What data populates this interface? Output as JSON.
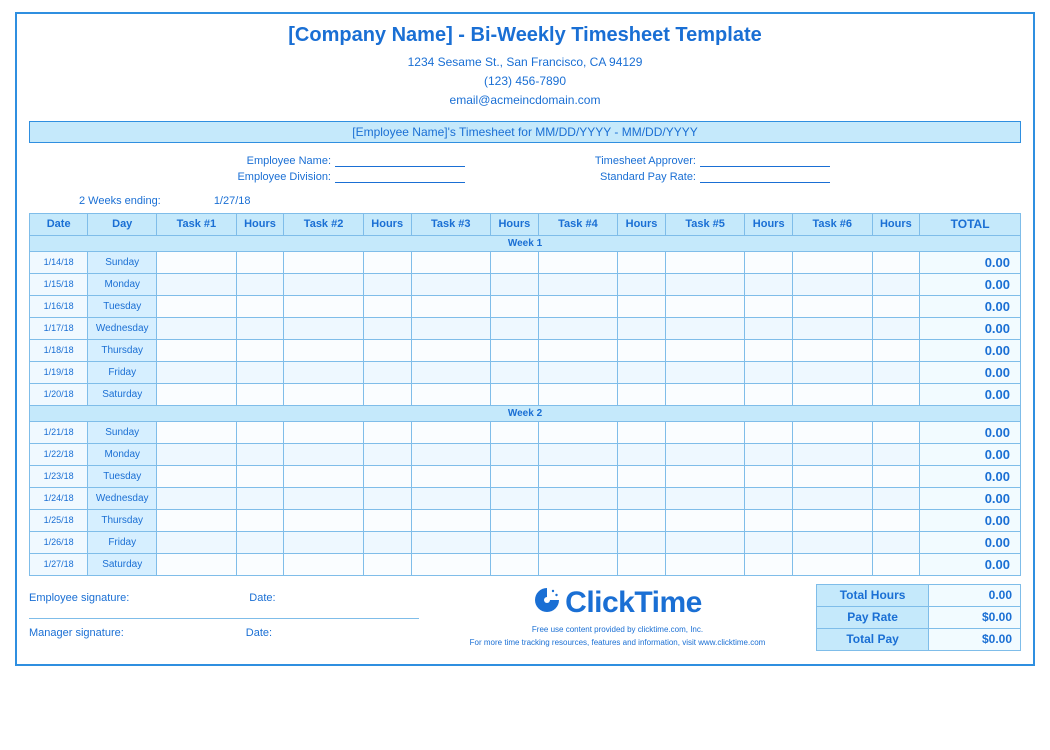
{
  "header": {
    "title": "[Company Name] - Bi-Weekly Timesheet Template",
    "address": "1234 Sesame St.,  San Francisco, CA 94129",
    "phone": "(123) 456-7890",
    "email": "email@acmeincdomain.com"
  },
  "banner": "[Employee Name]'s Timesheet for MM/DD/YYYY - MM/DD/YYYY",
  "info": {
    "emp_name_lbl": "Employee Name:",
    "emp_div_lbl": "Employee Division:",
    "approver_lbl": "Timesheet Approver:",
    "payrate_lbl": "Standard Pay Rate:"
  },
  "ending": {
    "label": "2 Weeks ending:",
    "value": "1/27/18"
  },
  "columns": {
    "date": "Date",
    "day": "Day",
    "t1": "Task #1",
    "t2": "Task #2",
    "t3": "Task #3",
    "t4": "Task #4",
    "t5": "Task #5",
    "t6": "Task #6",
    "hours": "Hours",
    "total": "TOTAL"
  },
  "week1_label": "Week 1",
  "week2_label": "Week 2",
  "week1": [
    {
      "date": "1/14/18",
      "day": "Sunday",
      "total": "0.00"
    },
    {
      "date": "1/15/18",
      "day": "Monday",
      "total": "0.00"
    },
    {
      "date": "1/16/18",
      "day": "Tuesday",
      "total": "0.00"
    },
    {
      "date": "1/17/18",
      "day": "Wednesday",
      "total": "0.00"
    },
    {
      "date": "1/18/18",
      "day": "Thursday",
      "total": "0.00"
    },
    {
      "date": "1/19/18",
      "day": "Friday",
      "total": "0.00"
    },
    {
      "date": "1/20/18",
      "day": "Saturday",
      "total": "0.00"
    }
  ],
  "week2": [
    {
      "date": "1/21/18",
      "day": "Sunday",
      "total": "0.00"
    },
    {
      "date": "1/22/18",
      "day": "Monday",
      "total": "0.00"
    },
    {
      "date": "1/23/18",
      "day": "Tuesday",
      "total": "0.00"
    },
    {
      "date": "1/24/18",
      "day": "Wednesday",
      "total": "0.00"
    },
    {
      "date": "1/25/18",
      "day": "Thursday",
      "total": "0.00"
    },
    {
      "date": "1/26/18",
      "day": "Friday",
      "total": "0.00"
    },
    {
      "date": "1/27/18",
      "day": "Saturday",
      "total": "0.00"
    }
  ],
  "signatures": {
    "emp": "Employee signature:",
    "mgr": "Manager signature:",
    "date": "Date:"
  },
  "brand": {
    "name": "ClickTime",
    "fine1": "Free use content provided by clicktime.com, Inc.",
    "fine2": "For more time tracking resources, features and information, visit www.clicktime.com"
  },
  "summary": {
    "total_hours_lbl": "Total Hours",
    "total_hours_val": "0.00",
    "pay_rate_lbl": "Pay Rate",
    "pay_rate_val": "$0.00",
    "total_pay_lbl": "Total Pay",
    "total_pay_val": "$0.00"
  }
}
